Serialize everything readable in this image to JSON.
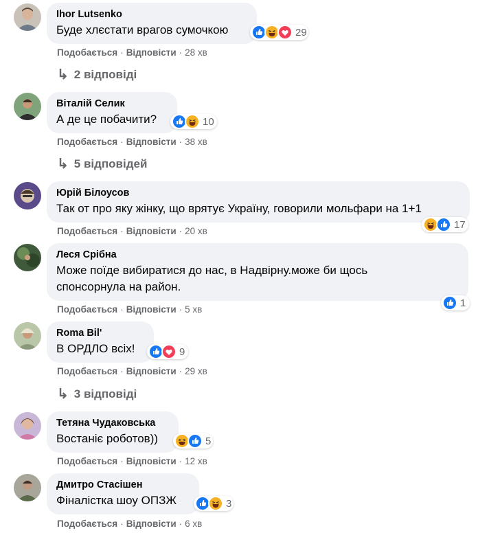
{
  "labels": {
    "like": "Подобається",
    "reply": "Відповісти",
    "dot": "·"
  },
  "colors": {
    "like_blue": "#1877f2",
    "love_red": "#f33e58",
    "haha_yellow": "#f7b125"
  },
  "comments": [
    {
      "author": "Ihor Lutsenko",
      "text": [
        "Буде хлєстати врагов сумочкою"
      ],
      "reactions": [
        "like",
        "haha",
        "love"
      ],
      "count": "29",
      "time": "28 хв",
      "replies": "2 відповіді"
    },
    {
      "author": "Віталій Селик",
      "text": [
        "А де це побачити?"
      ],
      "reactions": [
        "like",
        "haha"
      ],
      "count": "10",
      "time": "38 хв",
      "replies": "5 відповідей"
    },
    {
      "author": "Юрій Білоусов",
      "text": [
        "Так от про яку жінку, що врятує Україну, говорили мольфари на 1+1"
      ],
      "reactions": [
        "haha",
        "like"
      ],
      "count": "17",
      "time": "20 хв"
    },
    {
      "author": "Леся Срібна",
      "text": [
        "Може поїде вибиратися до нас, в Надвірну.може би щось",
        "спонсорнула на район."
      ],
      "reactions": [
        "like"
      ],
      "count": "1",
      "time": "5 хв"
    },
    {
      "author": "Roma Bil'",
      "text": [
        "В ОРДЛО всіх!"
      ],
      "reactions": [
        "like",
        "love"
      ],
      "count": "9",
      "time": "29 хв",
      "replies": "3 відповіді"
    },
    {
      "author": "Тетяна Чудаковська",
      "text": [
        "Востаніє роботов))"
      ],
      "reactions": [
        "haha",
        "like"
      ],
      "count": "5",
      "time": "12 хв"
    },
    {
      "author": "Дмитро Стасішен",
      "text": [
        "Фіналістка шоу ОПЗЖ"
      ],
      "reactions": [
        "like",
        "haha"
      ],
      "count": "3",
      "time": "6 хв"
    }
  ]
}
